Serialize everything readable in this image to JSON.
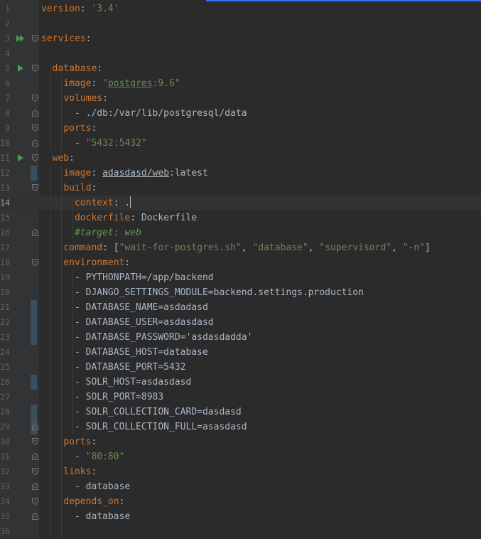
{
  "editor": {
    "current_line": 14,
    "lines": [
      {
        "n": "1",
        "segs": [
          {
            "t": "version",
            "c": "k"
          },
          {
            "t": ": ",
            "c": "p"
          },
          {
            "t": "'3.4'",
            "c": "s"
          }
        ]
      },
      {
        "n": "2",
        "segs": []
      },
      {
        "n": "3",
        "segs": [
          {
            "t": "services",
            "c": "k"
          },
          {
            "t": ":",
            "c": "p"
          }
        ]
      },
      {
        "n": "4",
        "segs": []
      },
      {
        "n": "5",
        "segs": [
          {
            "t": "  ",
            "c": "p"
          },
          {
            "t": "database",
            "c": "k"
          },
          {
            "t": ":",
            "c": "p"
          }
        ]
      },
      {
        "n": "6",
        "segs": [
          {
            "t": "    ",
            "c": "p"
          },
          {
            "t": "image",
            "c": "k"
          },
          {
            "t": ": ",
            "c": "p"
          },
          {
            "t": "\"",
            "c": "s"
          },
          {
            "t": "postgres",
            "c": "s u"
          },
          {
            "t": ":9.6\"",
            "c": "s"
          }
        ]
      },
      {
        "n": "7",
        "segs": [
          {
            "t": "    ",
            "c": "p"
          },
          {
            "t": "volumes",
            "c": "k"
          },
          {
            "t": ":",
            "c": "p"
          }
        ]
      },
      {
        "n": "8",
        "segs": [
          {
            "t": "      - ./db:/var/lib/postgresql/data",
            "c": "p"
          }
        ]
      },
      {
        "n": "9",
        "segs": [
          {
            "t": "    ",
            "c": "p"
          },
          {
            "t": "ports",
            "c": "k"
          },
          {
            "t": ":",
            "c": "p"
          }
        ]
      },
      {
        "n": "10",
        "segs": [
          {
            "t": "      - ",
            "c": "p"
          },
          {
            "t": "\"5432:5432\"",
            "c": "s"
          }
        ]
      },
      {
        "n": "11",
        "segs": [
          {
            "t": "  ",
            "c": "p"
          },
          {
            "t": "web",
            "c": "k"
          },
          {
            "t": ":",
            "c": "p"
          }
        ]
      },
      {
        "n": "12",
        "segs": [
          {
            "t": "    ",
            "c": "p"
          },
          {
            "t": "image",
            "c": "k"
          },
          {
            "t": ": ",
            "c": "p"
          },
          {
            "t": "adasdasd/web",
            "c": "p u"
          },
          {
            "t": ":latest",
            "c": "p"
          }
        ]
      },
      {
        "n": "13",
        "segs": [
          {
            "t": "    ",
            "c": "p"
          },
          {
            "t": "build",
            "c": "k"
          },
          {
            "t": ":",
            "c": "p"
          }
        ]
      },
      {
        "n": "14",
        "segs": [
          {
            "t": "      ",
            "c": "p"
          },
          {
            "t": "context",
            "c": "k"
          },
          {
            "t": ": .",
            "c": "p"
          }
        ],
        "caret": true
      },
      {
        "n": "15",
        "segs": [
          {
            "t": "      ",
            "c": "p"
          },
          {
            "t": "dockerfile",
            "c": "k"
          },
          {
            "t": ": Dockerfile",
            "c": "p"
          }
        ]
      },
      {
        "n": "16",
        "segs": [
          {
            "t": "      ",
            "c": "p"
          },
          {
            "t": "#target: web",
            "c": "c"
          }
        ]
      },
      {
        "n": "17",
        "segs": [
          {
            "t": "    ",
            "c": "p"
          },
          {
            "t": "command",
            "c": "k"
          },
          {
            "t": ": [",
            "c": "p"
          },
          {
            "t": "\"wait-for-postgres.sh\"",
            "c": "s"
          },
          {
            "t": ", ",
            "c": "p"
          },
          {
            "t": "\"database\"",
            "c": "s"
          },
          {
            "t": ", ",
            "c": "p"
          },
          {
            "t": "\"supervisord\"",
            "c": "s"
          },
          {
            "t": ", ",
            "c": "p"
          },
          {
            "t": "\"-n\"",
            "c": "s"
          },
          {
            "t": "]",
            "c": "p"
          }
        ]
      },
      {
        "n": "18",
        "segs": [
          {
            "t": "    ",
            "c": "p"
          },
          {
            "t": "environment",
            "c": "k"
          },
          {
            "t": ":",
            "c": "p"
          }
        ]
      },
      {
        "n": "19",
        "segs": [
          {
            "t": "      - PYTHONPATH=/app/backend",
            "c": "p"
          }
        ]
      },
      {
        "n": "20",
        "segs": [
          {
            "t": "      - DJANGO_SETTINGS_MODULE=backend.settings.production",
            "c": "p"
          }
        ]
      },
      {
        "n": "21",
        "segs": [
          {
            "t": "      - DATABASE_NAME=asdadasd",
            "c": "p"
          }
        ]
      },
      {
        "n": "22",
        "segs": [
          {
            "t": "      - DATABASE_USER=asdasdasd",
            "c": "p"
          }
        ]
      },
      {
        "n": "23",
        "segs": [
          {
            "t": "      - DATABASE_PASSWORD='asdasdadda'",
            "c": "p"
          }
        ]
      },
      {
        "n": "24",
        "segs": [
          {
            "t": "      - DATABASE_HOST=database",
            "c": "p"
          }
        ]
      },
      {
        "n": "25",
        "segs": [
          {
            "t": "      - DATABASE_PORT=5432",
            "c": "p"
          }
        ]
      },
      {
        "n": "26",
        "segs": [
          {
            "t": "      - SOLR_HOST=asdasdasd",
            "c": "p"
          }
        ]
      },
      {
        "n": "27",
        "segs": [
          {
            "t": "      - SOLR_PORT=8983",
            "c": "p"
          }
        ]
      },
      {
        "n": "28",
        "segs": [
          {
            "t": "      - SOLR_COLLECTION_CARD=dasdasd",
            "c": "p"
          }
        ]
      },
      {
        "n": "29",
        "segs": [
          {
            "t": "      - SOLR_COLLECTION_FULL=asasdasd",
            "c": "p"
          }
        ]
      },
      {
        "n": "30",
        "segs": [
          {
            "t": "    ",
            "c": "p"
          },
          {
            "t": "ports",
            "c": "k"
          },
          {
            "t": ":",
            "c": "p"
          }
        ]
      },
      {
        "n": "31",
        "segs": [
          {
            "t": "      - ",
            "c": "p"
          },
          {
            "t": "\"80:80\"",
            "c": "s"
          }
        ]
      },
      {
        "n": "32",
        "segs": [
          {
            "t": "    ",
            "c": "p"
          },
          {
            "t": "links",
            "c": "k"
          },
          {
            "t": ":",
            "c": "p"
          }
        ]
      },
      {
        "n": "33",
        "segs": [
          {
            "t": "      - database",
            "c": "p"
          }
        ]
      },
      {
        "n": "34",
        "segs": [
          {
            "t": "    ",
            "c": "p"
          },
          {
            "t": "depends_on",
            "c": "k"
          },
          {
            "t": ":",
            "c": "p"
          }
        ]
      },
      {
        "n": "35",
        "segs": [
          {
            "t": "      - database",
            "c": "p"
          }
        ]
      },
      {
        "n": "36",
        "segs": []
      }
    ],
    "run_icons": {
      "3": "run-all-services-icon",
      "5": "run-service-icon",
      "11": "run-service-icon"
    },
    "fold_icons": {
      "3": "fold",
      "5": "fold",
      "7": "fold",
      "8": "end",
      "9": "fold",
      "10": "end",
      "11": "fold",
      "13": "fold",
      "16": "end",
      "18": "fold",
      "29": "end",
      "30": "fold",
      "31": "end",
      "32": "fold",
      "33": "end",
      "34": "fold",
      "35": "end"
    },
    "changed_lines": [
      12,
      21,
      22,
      23,
      26,
      28,
      29
    ],
    "colors": {
      "background": "#2b2b2b",
      "gutter": "#313335",
      "keyword": "#cc7832",
      "string": "#6a8759",
      "plain": "#a9b7c6",
      "comment": "#629755",
      "run_icon": "#499c54",
      "change_marker": "#3c4f5c"
    }
  }
}
